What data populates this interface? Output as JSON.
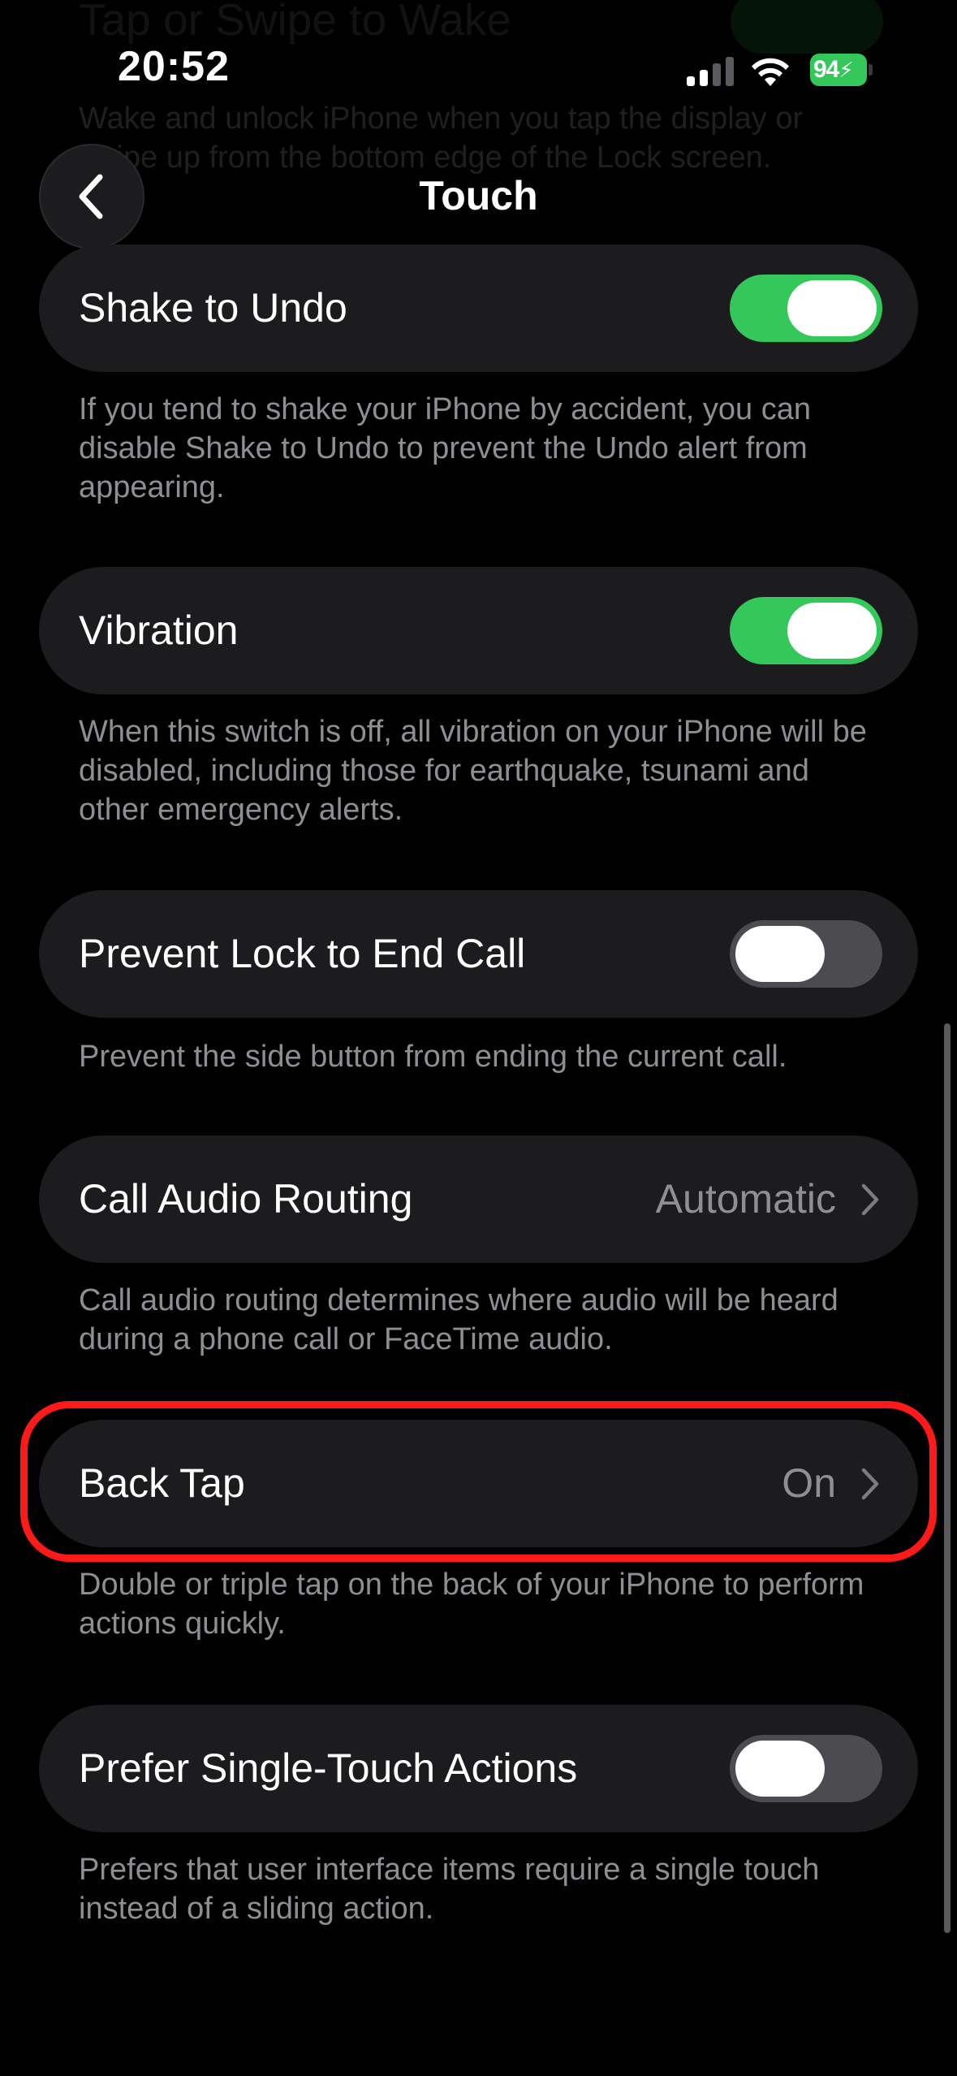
{
  "status_bar": {
    "time": "20:52",
    "battery": "94",
    "icons": [
      "cellular-signal-icon",
      "wifi-icon",
      "battery-charging-icon"
    ]
  },
  "background_section": {
    "title": "Tap or Swipe to Wake",
    "description": "Wake and unlock iPhone when you tap the display or swipe up from the bottom edge of the Lock screen."
  },
  "nav": {
    "title": "Touch",
    "back_icon": "chevron-left-icon"
  },
  "settings": [
    {
      "label": "Shake to Undo",
      "type": "toggle",
      "state": "on",
      "description": "If you tend to shake your iPhone by accident, you can disable Shake to Undo to prevent the Undo alert from appearing."
    },
    {
      "label": "Vibration",
      "type": "toggle",
      "state": "on",
      "description": "When this switch is off, all vibration on your iPhone will be disabled, including those for earthquake, tsunami and other emergency alerts."
    },
    {
      "label": "Prevent Lock to End Call",
      "type": "toggle",
      "state": "off",
      "description": "Prevent the side button from ending the current call."
    },
    {
      "label": "Call Audio Routing",
      "type": "link",
      "value": "Automatic",
      "description": "Call audio routing determines where audio will be heard during a phone call or FaceTime audio."
    },
    {
      "label": "Back Tap",
      "type": "link",
      "value": "On",
      "highlighted": true,
      "description": "Double or triple tap on the back of your iPhone to perform actions quickly."
    },
    {
      "label": "Prefer Single-Touch Actions",
      "type": "toggle",
      "state": "off",
      "description": "Prefers that user interface items require a single touch instead of a sliding action."
    }
  ],
  "colors": {
    "background": "#000000",
    "row_background": "#1c1c1e",
    "toggle_on": "#34c759",
    "toggle_off": "#4c4c50",
    "secondary_text": "#8e8e93",
    "highlight_border": "#ff1a1a"
  }
}
